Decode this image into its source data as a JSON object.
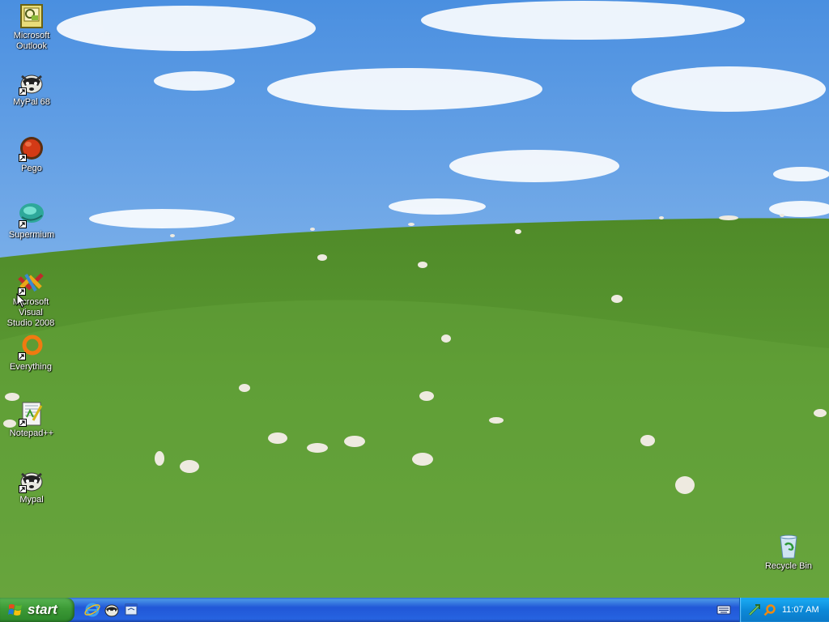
{
  "desktop": {
    "icons": [
      {
        "label_line1": "Microsoft",
        "label_line2": "Outlook",
        "icon": "outlook-icon"
      },
      {
        "label_line1": "MyPal 68",
        "label_line2": "",
        "icon": "mypal-icon"
      },
      {
        "label_line1": "Pego",
        "label_line2": "",
        "icon": "pego-icon"
      },
      {
        "label_line1": "Supermium",
        "label_line2": "",
        "icon": "supermium-icon"
      },
      {
        "label_line1": "Microsoft Visual",
        "label_line2": "Studio 2008",
        "icon": "visual-studio-icon"
      },
      {
        "label_line1": "Everything",
        "label_line2": "",
        "icon": "everything-icon"
      },
      {
        "label_line1": "Notepad++",
        "label_line2": "",
        "icon": "notepad-plus-plus-icon"
      },
      {
        "label_line1": "Mypal",
        "label_line2": "",
        "icon": "mypal-icon"
      },
      {
        "label_line1": "Recycle Bin",
        "label_line2": "",
        "icon": "recycle-bin-icon"
      }
    ]
  },
  "taskbar": {
    "start_label": "start",
    "quick_launch": [
      "internet-explorer-icon",
      "mypal-icon",
      "show-desktop-icon"
    ],
    "tray_icons": [
      "network-icon",
      "search-icon"
    ],
    "clock": "11:07 AM"
  },
  "colors": {
    "taskbar_blue": "#245edb",
    "start_green": "#3c9a36",
    "tray_blue": "#0c8ad9"
  }
}
